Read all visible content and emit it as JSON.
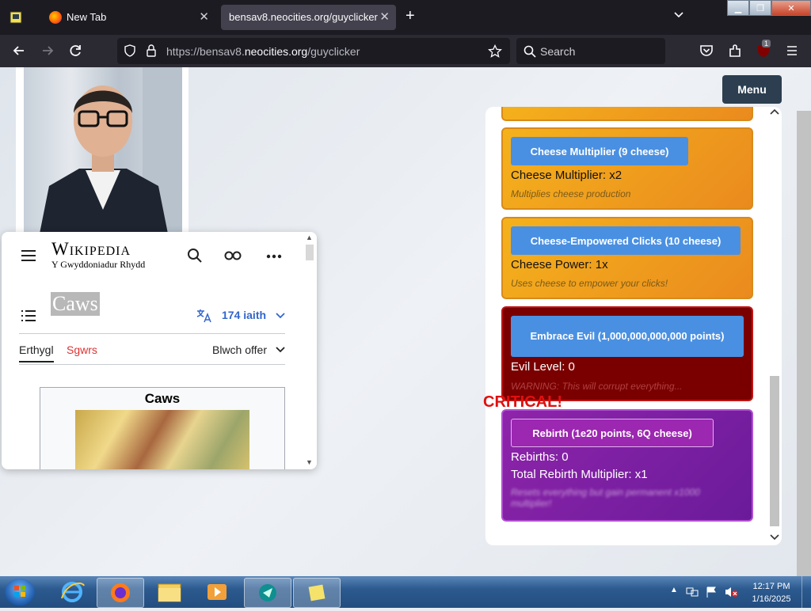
{
  "browser": {
    "tabs": [
      {
        "label": "New Tab",
        "active": false
      },
      {
        "label": "bensav8.neocities.org/guyclicker",
        "active": true
      }
    ],
    "url": {
      "prefix": "https://bensav8.",
      "domain": "neocities.org",
      "path": "/guyclicker"
    },
    "search_placeholder": "Search",
    "extension_badge": "1"
  },
  "page": {
    "menu_label": "Menu",
    "wikipedia": {
      "wordmark": "Wikipedia",
      "tagline": "Y Gwyddoniadur Rhydd",
      "article_title": "Caws",
      "languages": "174 iaith",
      "tabs": [
        "Erthygl",
        "Sgwrs"
      ],
      "toolbox": "Blwch offer",
      "infobox_title": "Caws"
    },
    "upgrades": [
      {
        "button": "Cheese Multiplier (9 cheese)",
        "stat": "Cheese Multiplier: x2",
        "desc": "Multiplies cheese production"
      },
      {
        "button": "Cheese-Empowered Clicks (10 cheese)",
        "stat": "Cheese Power: 1x",
        "desc": "Uses cheese to empower your clicks!"
      }
    ],
    "evil": {
      "button": "Embrace Evil (1,000,000,000,000 points)",
      "stat": "Evil Level: 0",
      "warning": "WARNING: This will corrupt everything..."
    },
    "critical": "CRITICAL!",
    "rebirth": {
      "button": "Rebirth (1e20 points, 6Q cheese)",
      "stat1": "Rebirths: 0",
      "stat2": "Total Rebirth Multiplier: x1",
      "desc": "Resets everything but gain permanent x1000 multiplier!"
    }
  },
  "taskbar": {
    "time": "12:17 PM",
    "date": "1/16/2025"
  },
  "colors": {
    "accent_blue": "#4a90e2",
    "evil_red": "#7a0000",
    "rebirth_purple": "#8e24aa",
    "cheese_orange": "#f5b21c"
  }
}
